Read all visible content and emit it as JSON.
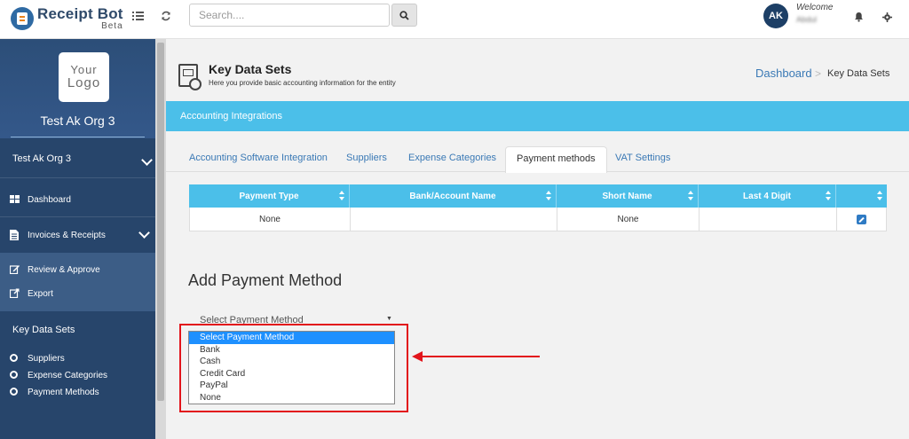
{
  "app": {
    "name": "Receipt Bot",
    "badge": "Beta"
  },
  "search": {
    "placeholder": "Search...."
  },
  "user": {
    "initials": "AK",
    "welcome": "Welcome",
    "name": "Abdul"
  },
  "sidebar": {
    "logo_line1": "Your",
    "logo_line2": "Logo",
    "org_title": "Test Ak Org 3",
    "org_select": "Test Ak Org 3",
    "nav": {
      "dashboard": "Dashboard",
      "invoices": "Invoices & Receipts",
      "review": "Review & Approve",
      "export": "Export"
    },
    "key_data_sets_label": "Key Data Sets",
    "key_items": [
      "Suppliers",
      "Expense Categories",
      "Payment Methods"
    ]
  },
  "page": {
    "title": "Key Data Sets",
    "subtitle": "Here you provide basic accounting information for the entity",
    "breadcrumb": {
      "dashboard": "Dashboard",
      "current": "Key Data Sets"
    },
    "banner": "Accounting Integrations"
  },
  "tabs": [
    {
      "label": "Accounting Software Integration",
      "active": false
    },
    {
      "label": "Suppliers",
      "active": false
    },
    {
      "label": "Expense Categories",
      "active": false
    },
    {
      "label": "Payment methods",
      "active": true
    },
    {
      "label": "VAT Settings",
      "active": false
    }
  ],
  "table": {
    "columns": [
      "Payment Type",
      "Bank/Account Name",
      "Short Name",
      "Last 4 Digit",
      ""
    ],
    "rows": [
      [
        "None",
        "",
        "None",
        "",
        ""
      ]
    ]
  },
  "add_payment": {
    "title": "Add Payment Method",
    "select_value": "Select Payment Method",
    "options": [
      "Select Payment Method",
      "Bank",
      "Cash",
      "Credit Card",
      "PayPal",
      "None"
    ],
    "selected_index": 0
  },
  "colors": {
    "sidebar_bg": "#27456b",
    "accent": "#4bbfe9",
    "link": "#3a79b5",
    "annotation": "#e2141b"
  }
}
